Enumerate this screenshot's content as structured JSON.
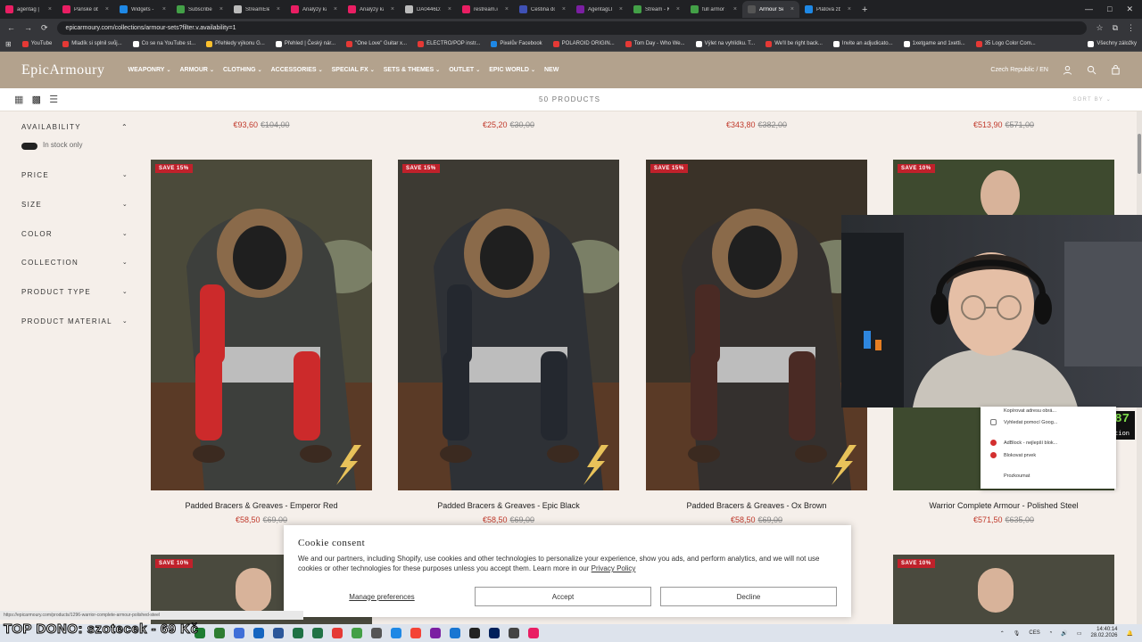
{
  "browser": {
    "tabs": [
      {
        "label": "agentag | Soun",
        "color": "#e91e63"
      },
      {
        "label": "Pánské oblečení",
        "color": "#e91e63"
      },
      {
        "label": "Widgets - Pulse",
        "color": "#1e88e5"
      },
      {
        "label": "Subscribe to Ap",
        "color": "#43a047"
      },
      {
        "label": "StreamElements",
        "color": "#bbbbbb"
      },
      {
        "label": "Analýzy kanálu",
        "color": "#e91e63"
      },
      {
        "label": "Analýzy kanálu",
        "color": "#e91e63"
      },
      {
        "label": "DA0446D1ADE",
        "color": "#bbbbbb"
      },
      {
        "label": "restream.io ch",
        "color": "#e91e63"
      },
      {
        "label": "Čeština do Res",
        "color": "#3f51b5"
      },
      {
        "label": "AgentagLIVE",
        "color": "#7b1fa2"
      },
      {
        "label": "Stream - Kick D",
        "color": "#43a047"
      },
      {
        "label": "full armor set",
        "color": "#43a047"
      },
      {
        "label": "Armour Sets",
        "color": "#555555"
      },
      {
        "label": "Plátová zbroj",
        "color": "#1e88e5"
      }
    ],
    "active_tab_index": 13,
    "url": "epicarmoury.com/collections/armour-sets?filter.v.availability=1",
    "bookmarks": [
      {
        "label": "YouTube",
        "color": "#e53935"
      },
      {
        "label": "Mladík si splnil svůj...",
        "color": "#e53935"
      },
      {
        "label": "Co se na YouTube st...",
        "color": "#ffffff"
      },
      {
        "label": "Přehledy výkonu G...",
        "color": "#fbc02d"
      },
      {
        "label": "Přehled | Český nár...",
        "color": "#ffffff"
      },
      {
        "label": "\"One Love\" Guitar x...",
        "color": "#e53935"
      },
      {
        "label": "ELECTRO/POP instr...",
        "color": "#e53935"
      },
      {
        "label": "Pixelův Facebook",
        "color": "#1e88e5"
      },
      {
        "label": "POLAROID ORIGIN...",
        "color": "#e53935"
      },
      {
        "label": "Tom Day - Who We...",
        "color": "#e53935"
      },
      {
        "label": "Výlet na vyhlídku. T...",
        "color": "#ffffff"
      },
      {
        "label": "We'll be right back...",
        "color": "#e53935"
      },
      {
        "label": "Invite an adjudicato...",
        "color": "#ffffff"
      },
      {
        "label": "1xetgame and 1xetti...",
        "color": "#ffffff"
      },
      {
        "label": "35 Logo Color Com...",
        "color": "#e53935"
      },
      {
        "label": "Všechny záložky",
        "color": "#ffffff"
      }
    ]
  },
  "site": {
    "logo": "EpicArmoury",
    "nav": [
      "WEAPONRY",
      "ARMOUR",
      "CLOTHING",
      "ACCESSORIES",
      "SPECIAL FX",
      "SETS & THEMES",
      "OUTLET",
      "EPIC WORLD",
      "NEW"
    ],
    "region": "Czech Republic / EN",
    "product_count": "50 PRODUCTS",
    "sort_label": "SORT BY"
  },
  "filters": {
    "availability": "AVAILABILITY",
    "in_stock": "In stock only",
    "items": [
      "PRICE",
      "SIZE",
      "COLOR",
      "COLLECTION",
      "PRODUCT TYPE",
      "PRODUCT MATERIAL"
    ]
  },
  "top_prices": [
    {
      "new": "€93,60",
      "old": "€104,00"
    },
    {
      "new": "€25,20",
      "old": "€30,00"
    },
    {
      "new": "€343,80",
      "old": "€382,00"
    },
    {
      "new": "€513,90",
      "old": "€571,00"
    }
  ],
  "products": [
    {
      "badge": "SAVE 15%",
      "title": "Padded Bracers & Greaves - Emperor Red",
      "new": "€58,50",
      "old": "€69,00",
      "cloak": "#3d3f3c",
      "leg": "#cc2a2b"
    },
    {
      "badge": "SAVE 15%",
      "title": "Padded Bracers & Greaves - Epic Black",
      "new": "€58,50",
      "old": "€69,00",
      "cloak": "#2e3136",
      "leg": "#24282f"
    },
    {
      "badge": "SAVE 15%",
      "title": "Padded Bracers & Greaves - Ox Brown",
      "new": "€58,50",
      "old": "€69,00",
      "cloak": "#34302e",
      "leg": "#4a2a24"
    },
    {
      "badge": "SAVE 10%",
      "title": "Warrior Complete Armour - Polished Steel",
      "new": "€571,50",
      "old": "€635,00",
      "cloak": "#3b3f44",
      "leg": "#6d6f72"
    }
  ],
  "bottom_badges": [
    "SAVE 10%",
    "SAVE 10%"
  ],
  "cookie": {
    "title": "Cookie consent",
    "text": "We and our partners, including Shopify, use cookies and other technologies to personalize your experience, show you ads, and perform analytics, and we will not use cookies or other technologies for these purposes unless you accept them. Learn more in our",
    "link": "Privacy Policy",
    "manage": "Manage preferences",
    "accept": "Accept",
    "decline": "Decline"
  },
  "context_menu": [
    "Kopírovat adresu obrá...",
    "Vyhledat pomocí Goog...",
    "AdBlock - nejlepší blok...",
    "Blokovat prvek",
    "Prozkoumat"
  ],
  "caution": {
    "value": "87",
    "label": "Caution"
  },
  "status_bar": "https://epicarmoury.com/products/1296-warrior-complete-armour-polished-steel",
  "overlay_text": "TOP DONO: szotecek - 69 Kč",
  "clock": {
    "time": "14:40:14",
    "date": "28.02.2026"
  },
  "tray_lang": "CES"
}
